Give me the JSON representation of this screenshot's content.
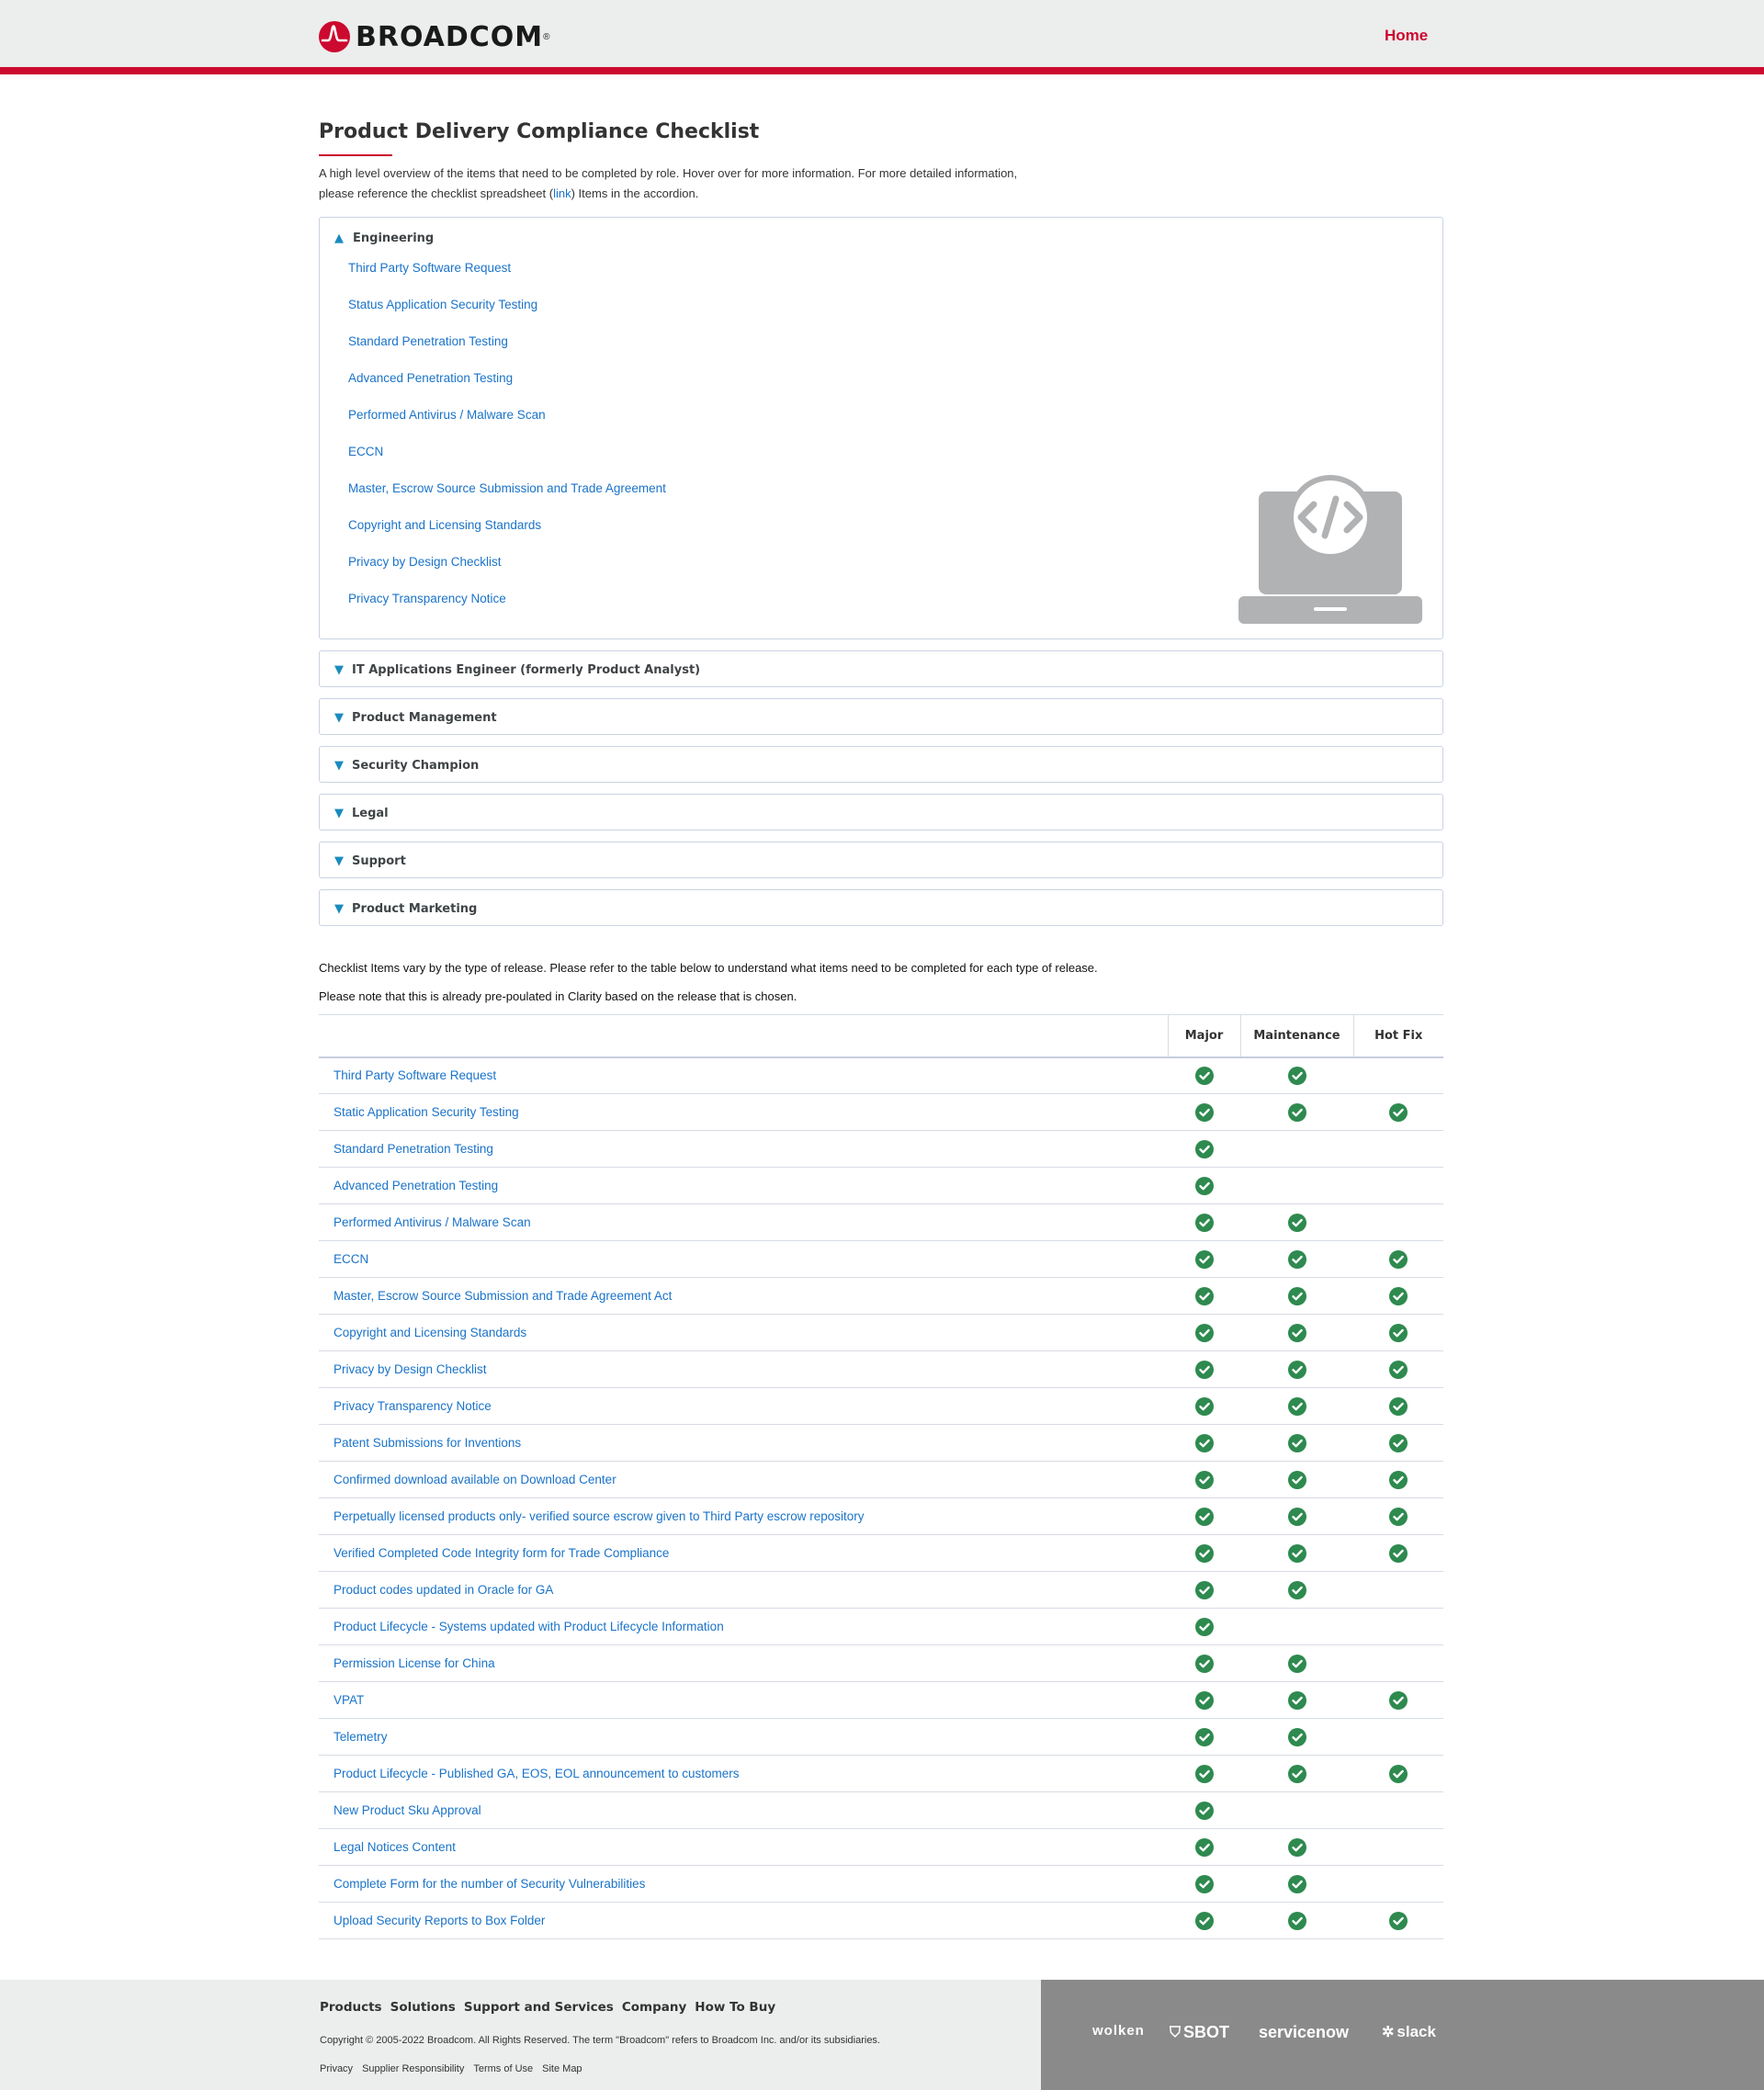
{
  "header": {
    "brand": "BROADCOM",
    "brand_mark": "®",
    "home_label": "Home",
    "brand_color": "#cc092f"
  },
  "page": {
    "title": "Product Delivery Compliance Checklist",
    "intro_line1": "A high level overview of the items that need to be completed by role. Hover over for more information. For more detailed information,",
    "intro_line2_before": "please reference the checklist spreadsheet (",
    "intro_link": "link",
    "intro_line2_after": ") Items in the accordion."
  },
  "accordion": {
    "open_section": {
      "title": "Engineering",
      "items": [
        "Third Party Software Request",
        "Status Application Security Testing",
        "Standard Penetration Testing",
        "Advanced Penetration Testing",
        "Performed Antivirus / Malware Scan",
        "ECCN",
        "Master, Escrow Source Submission and Trade Agreement",
        "Copyright and Licensing Standards",
        "Privacy by Design Checklist",
        "Privacy Transparency Notice"
      ],
      "illustration_icon": "laptop-code-icon"
    },
    "closed_sections": [
      "IT Applications Engineer (formerly Product Analyst)",
      "Product Management",
      "Security Champion",
      "Legal",
      "Support",
      "Product Marketing"
    ]
  },
  "release_notes": {
    "line1": "Checklist Items vary by the type of release. Please refer to the table below to understand what items need to be completed for each type of release.",
    "line2": "Please note that this is already pre-poulated in Clarity based on the release that is chosen."
  },
  "release_table": {
    "headers": [
      "",
      "Major",
      "Maintenance",
      "Hot Fix"
    ],
    "check_icon": "check-circle-icon",
    "check_color": "#2e8a4f",
    "rows": [
      {
        "item": "Third Party Software Request",
        "major": true,
        "maintenance": true,
        "hotfix": false
      },
      {
        "item": " Static Application Security Testing",
        "major": true,
        "maintenance": true,
        "hotfix": true
      },
      {
        "item": "Standard Penetration Testing",
        "major": true,
        "maintenance": false,
        "hotfix": false
      },
      {
        "item": "Advanced Penetration Testing",
        "major": true,
        "maintenance": false,
        "hotfix": false
      },
      {
        "item": "Performed Antivirus / Malware Scan",
        "major": true,
        "maintenance": true,
        "hotfix": false
      },
      {
        "item": "ECCN",
        "major": true,
        "maintenance": true,
        "hotfix": true
      },
      {
        "item": "Master, Escrow Source Submission and Trade Agreement Act",
        "major": true,
        "maintenance": true,
        "hotfix": true
      },
      {
        "item": "Copyright and Licensing Standards",
        "major": true,
        "maintenance": true,
        "hotfix": true
      },
      {
        "item": "Privacy by Design Checklist",
        "major": true,
        "maintenance": true,
        "hotfix": true
      },
      {
        "item": "Privacy Transparency Notice",
        "major": true,
        "maintenance": true,
        "hotfix": true
      },
      {
        "item": "Patent Submissions for Inventions",
        "major": true,
        "maintenance": true,
        "hotfix": true
      },
      {
        "item": "Confirmed download available on Download Center",
        "major": true,
        "maintenance": true,
        "hotfix": true
      },
      {
        "item": "Perpetually licensed products only- verified source escrow given to Third Party escrow repository",
        "major": true,
        "maintenance": true,
        "hotfix": true
      },
      {
        "item": "Verified Completed Code Integrity form for Trade Compliance",
        "major": true,
        "maintenance": true,
        "hotfix": true
      },
      {
        "item": "Product codes updated in Oracle for GA",
        "major": true,
        "maintenance": true,
        "hotfix": false
      },
      {
        "item": "Product Lifecycle -  Systems updated with Product Lifecycle Information",
        "major": true,
        "maintenance": false,
        "hotfix": false
      },
      {
        "item": "Permission License for China",
        "major": true,
        "maintenance": true,
        "hotfix": false
      },
      {
        "item": "VPAT",
        "major": true,
        "maintenance": true,
        "hotfix": true
      },
      {
        "item": "Telemetry",
        "major": true,
        "maintenance": true,
        "hotfix": false
      },
      {
        "item": "Product Lifecycle -  Published GA, EOS, EOL announcement to customers",
        "major": true,
        "maintenance": true,
        "hotfix": true
      },
      {
        "item": "New Product Sku Approval",
        "major": true,
        "maintenance": false,
        "hotfix": false
      },
      {
        "item": "Legal Notices Content",
        "major": true,
        "maintenance": true,
        "hotfix": false
      },
      {
        "item": "Complete Form for the number of Security Vulnerabilities",
        "major": true,
        "maintenance": true,
        "hotfix": false
      },
      {
        "item": "Upload Security Reports to Box Folder",
        "major": true,
        "maintenance": true,
        "hotfix": true
      }
    ]
  },
  "footer": {
    "nav": [
      "Products",
      "Solutions",
      "Support and Services",
      "Company",
      "How To Buy"
    ],
    "copyright": "Copyright © 2005-2022 Broadcom. All Rights Reserved. The term \"Broadcom\" refers to Broadcom Inc. and/or its subsidiaries.",
    "links": [
      "Privacy",
      "Supplier Responsibility",
      "Terms of Use",
      "Site Map"
    ],
    "partners": [
      "wolken",
      "SBOT",
      "servicenow",
      "slack"
    ]
  }
}
